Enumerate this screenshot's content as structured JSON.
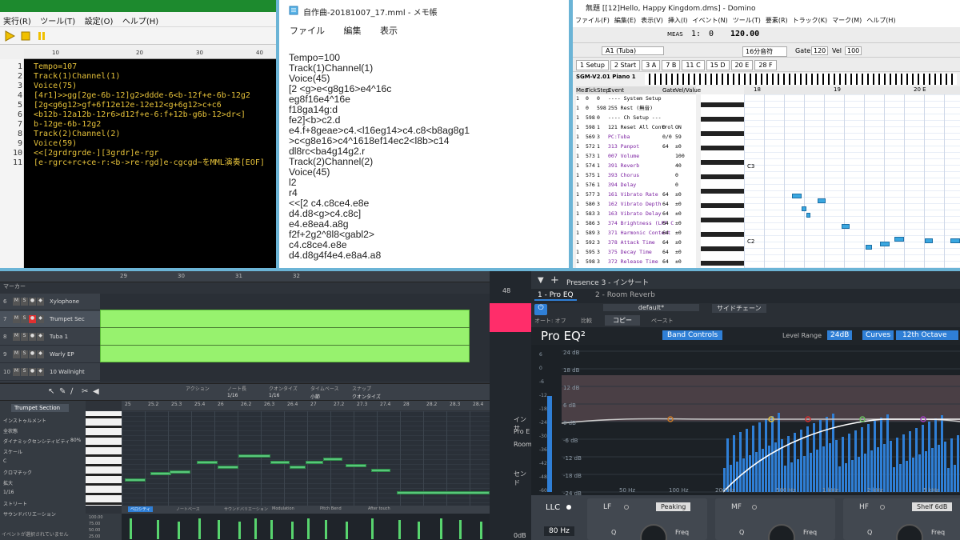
{
  "mml_editor": {
    "menu": [
      "実行(R)",
      "ツール(T)",
      "設定(O)",
      "ヘルプ(H)"
    ],
    "ruler_marks": [
      "10",
      "20",
      "30",
      "40"
    ],
    "lines": [
      {
        "n": "1",
        "text": "Tempo=107"
      },
      {
        "n": "2",
        "text": "Track(1)Channel(1)"
      },
      {
        "n": "3",
        "text": "Voice(75)"
      },
      {
        "n": "4",
        "text": "[4r1]>>gg[2ge-6b-12]g2>ddde-6<b-12f+e-6b-12g2"
      },
      {
        "n": "5",
        "text": "[2g<g6g12>gf+6f12e12e-12e12<g+6g12>c+c6"
      },
      {
        "n": "6",
        "text": "<b12b-12a12b-12r6>d12f+e-6:f+12b-g6b-12>dr<]"
      },
      {
        "n": "7",
        "text": "b-12ge-6b-12g2"
      },
      {
        "n": "8",
        "text": "Track(2)Channel(2)"
      },
      {
        "n": "9",
        "text": "Voice(59)"
      },
      {
        "n": "10",
        "text": "<<[2grdrgrde-][3grdr]e-rgr"
      },
      {
        "n": "11",
        "text": "[e-rgrc+rc+ce-r:<b->re-rgd]e-cgcgd~をMML演奏[EOF]"
      }
    ]
  },
  "notepad": {
    "title": "自作曲-20181007_17.mml - メモ帳",
    "menu": [
      "ファイル",
      "編集",
      "表示"
    ],
    "lines": [
      "Tempo=100",
      "Track(1)Channel(1)",
      "Voice(45)",
      "[2 <g>e<g8g16>e4^16c",
      "eg8f16e4^16e",
      "f18ga14g:d",
      "fe2]<b>c2.d",
      "e4.f+8geae>c4.<l16eg14>c4.c8<b8ag8g1",
      ">c<g8e16>c4^1618ef14ec2<l8b>c14",
      "dl8rc<ba4g14g2.r",
      "Track(2)Channel(2)",
      "Voice(45)",
      "l2",
      "r4",
      "<<[2 c4.c8ce4.e8e",
      "d4.d8<g>c4.c8c]",
      "e4.e8ea4.a8g",
      "f2f+2g2^8l8<gabl2>",
      "c4.c8ce4.e8e",
      "d4.d8g4f4e4.e8a4.a8"
    ]
  },
  "domino": {
    "title": "無題 [[12]Hello, Happy Kingdom.dms] - Domino",
    "menu": [
      "ファイル(F)",
      "編集(E)",
      "表示(V)",
      "挿入(I)",
      "イベント(N)",
      "ツール(T)",
      "要素(R)",
      "トラック(K)",
      "マーク(M)",
      "ヘルプ(H)"
    ],
    "measure": "1:",
    "beat": "0",
    "tempo": "120.00",
    "instrument": "A1 (Tuba)",
    "note_len": "16分音符",
    "gate": "120",
    "vel": "100",
    "tabs": [
      "1 Setup",
      "2 Start",
      "3 A",
      "7 B",
      "11 C",
      "15 D",
      "20 E",
      "28 F"
    ],
    "module": "SGM-V2.01 Piano 1",
    "columns": [
      "Mea",
      "Tick",
      "Step",
      "Event",
      "Gate",
      "Vel/Value"
    ],
    "events": [
      [
        "1",
        "0",
        "0",
        "---- System Setup",
        "",
        ""
      ],
      [
        "1",
        "0",
        "598",
        "255 Rest (無音)",
        "",
        ""
      ],
      [
        "1",
        "598",
        "0",
        "---- Ch Setup ---",
        "",
        ""
      ],
      [
        "1",
        "598",
        "1",
        "121 Reset All Control",
        "0",
        "ON"
      ],
      [
        "1",
        "569",
        "3",
        "PC:Tuba",
        "0/0",
        "59"
      ],
      [
        "1",
        "572",
        "1",
        "313 Panpot",
        "64",
        "±0"
      ],
      [
        "1",
        "573",
        "1",
        "007 Volume",
        "",
        "100"
      ],
      [
        "1",
        "574",
        "1",
        "391 Reverb",
        "",
        "40"
      ],
      [
        "1",
        "575",
        "1",
        "393 Chorus",
        "",
        "0"
      ],
      [
        "1",
        "576",
        "1",
        "394 Delay",
        "",
        "0"
      ],
      [
        "1",
        "577",
        "3",
        "161 Vibrato Rate",
        "64",
        "±0"
      ],
      [
        "1",
        "580",
        "3",
        "162 Vibrato Depth",
        "64",
        "±0"
      ],
      [
        "1",
        "583",
        "3",
        "163 Vibrato Delay",
        "64",
        "±0"
      ],
      [
        "1",
        "586",
        "3",
        "374 Brightness (LPF C",
        "64",
        "±0"
      ],
      [
        "1",
        "589",
        "3",
        "371 Harmonic Content",
        "64",
        "±0"
      ],
      [
        "1",
        "592",
        "3",
        "378 Attack Time",
        "64",
        "±0"
      ],
      [
        "1",
        "595",
        "3",
        "375 Decay Time",
        "64",
        "±0"
      ],
      [
        "1",
        "598",
        "3",
        "372 Release Time",
        "64",
        "±0"
      ]
    ],
    "roll_measures": [
      "18",
      "19",
      "20 E"
    ],
    "roll_keys": [
      "C3",
      "C2"
    ]
  },
  "studio_one": {
    "tracks": [
      {
        "num": "6",
        "name": "Xylophone"
      },
      {
        "num": "7",
        "name": "Trumpet Sec"
      },
      {
        "num": "8",
        "name": "Tuba 1"
      },
      {
        "num": "9",
        "name": "Warly EP"
      },
      {
        "num": "10",
        "name": "10 Wallnight"
      }
    ],
    "markers_label": "マーカー",
    "editor_track": "Trumpet Section",
    "ruler_top": [
      "29",
      "30",
      "31",
      "32"
    ],
    "ruler_bottom": [
      "25",
      "25.2",
      "25.3",
      "25.4",
      "26",
      "26.2",
      "26.3",
      "26.4",
      "27",
      "27.2",
      "27.3",
      "27.4",
      "28",
      "28.2",
      "28.3",
      "28.4"
    ],
    "toolbar_labels": [
      "アクション",
      "ノート長",
      "クオンタイズ",
      "タイムベース",
      "スナップ"
    ],
    "toolbar_values": [
      "1/16",
      "1/16",
      "小節",
      "クオンタイズ"
    ],
    "left_rows": [
      "インストゥルメント",
      "全状態",
      "ダイナミックセンシティビティ",
      "スケール",
      "C",
      "クロマチック",
      "拡大",
      "1/16",
      "ストリート",
      "サウンドバリエーション"
    ],
    "percent": "80%",
    "cc_tabs": [
      "ベロシティ",
      "ノートベース",
      "サウンドバリエーション",
      "Modulation",
      "Pitch Bend",
      "After touch"
    ],
    "cc_scale": [
      "100.00",
      "75.00",
      "50.00",
      "25.00"
    ],
    "bottom_note": "イベントが選択されていません"
  },
  "pro_eq": {
    "header": "Presence 3 - インサート",
    "slot1": "1 - Pro EQ",
    "slot2": "2 - Room Reverb",
    "auto": "オート: オフ",
    "compare": "比較",
    "copy": "コピー",
    "paste": "ペースト",
    "preset": "default*",
    "sidechain": "サイドチェーン",
    "plugin_name": "Pro EQ²",
    "band_controls": "Band Controls",
    "level_range_label": "Level Range",
    "level_range_value": "24dB",
    "curves": "Curves",
    "octave": "12th Octave",
    "db_scale": [
      "24 dB",
      "18 dB",
      "12 dB",
      "6 dB",
      "0 dB",
      "-6 dB",
      "-12 dB",
      "-18 dB",
      "-24 dB"
    ],
    "meter_scale": [
      "6",
      "0",
      "-6",
      "-12",
      "-18",
      "-24",
      "-30",
      "-36",
      "-42",
      "-48",
      "-60"
    ],
    "freq_scale": [
      "50 Hz",
      "100 Hz",
      "200 Hz",
      "500 Hz",
      "1 kHz",
      "2 kHz",
      "5 kHz"
    ],
    "llc": "LLC",
    "llc_freq": "80 Hz",
    "bands": [
      {
        "name": "LF",
        "mode": "Peaking",
        "q": "Q",
        "freq": "Freq"
      },
      {
        "name": "MF",
        "mode": "",
        "q": "Q",
        "freq": "Freq"
      },
      {
        "name": "HF",
        "mode": "Shelf 6dB",
        "q": "Q",
        "freq": "Freq"
      }
    ],
    "side_labels": [
      "インサ",
      "Pro E",
      "Room",
      "センド"
    ],
    "side_value": "48",
    "side_db": "0dB"
  },
  "colors": {
    "mml_bg": "#000000",
    "mml_text": "#e6c23a",
    "s1_green": "#97f26e",
    "eq_blue": "#2f7fd6"
  }
}
